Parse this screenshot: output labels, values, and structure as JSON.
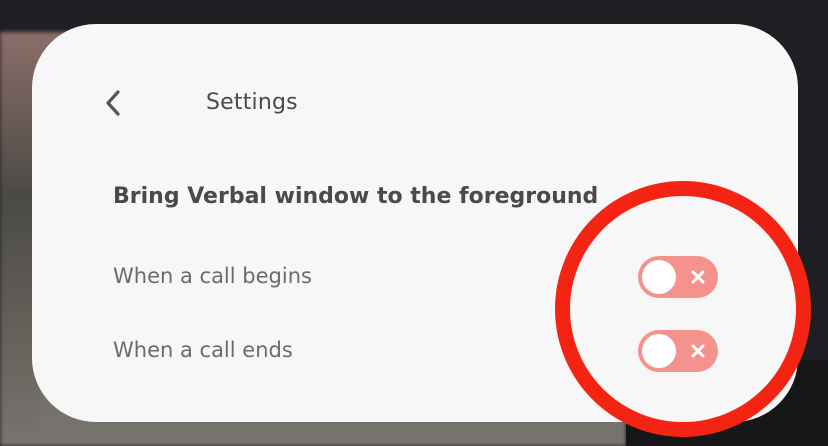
{
  "header": {
    "title": "Settings",
    "back_icon": "chevron-left-icon"
  },
  "section": {
    "title": "Bring Verbal window to the foreground"
  },
  "options": [
    {
      "label": "When a call begins",
      "enabled": false
    },
    {
      "label": "When a call ends",
      "enabled": false
    }
  ],
  "colors": {
    "toggle_off": "#f4938d",
    "highlight": "#f42414",
    "panel_bg": "#f7f7f7"
  }
}
